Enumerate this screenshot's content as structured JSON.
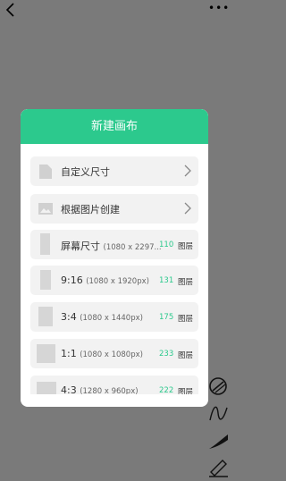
{
  "topbar": {
    "back_icon": "back-chevron-icon",
    "more_icon": "more-dots-icon",
    "more_glyph": "•••"
  },
  "tools": [
    "pen-slash-icon",
    "curve-icon",
    "brush-stroke-icon",
    "pen-edit-icon"
  ],
  "dialog": {
    "title": "新建画布",
    "options": [
      {
        "label": "自定义尺寸",
        "icon": "document-icon"
      },
      {
        "label": "根据图片创建",
        "icon": "image-icon"
      }
    ],
    "presets": [
      {
        "ratio": "屏幕尺寸",
        "dims": "(1080 x 2297...",
        "layers": "110",
        "layers_label": "图层"
      },
      {
        "ratio": "9:16",
        "dims": "(1080 x 1920px)",
        "layers": "131",
        "layers_label": "图层"
      },
      {
        "ratio": "3:4",
        "dims": "(1080 x 1440px)",
        "layers": "175",
        "layers_label": "图层"
      },
      {
        "ratio": "1:1",
        "dims": "(1080 x 1080px)",
        "layers": "233",
        "layers_label": "图层"
      },
      {
        "ratio": "4:3",
        "dims": "(1280 x 960px)",
        "layers": "222",
        "layers_label": "图层"
      }
    ],
    "accent": "#2cc98d"
  }
}
